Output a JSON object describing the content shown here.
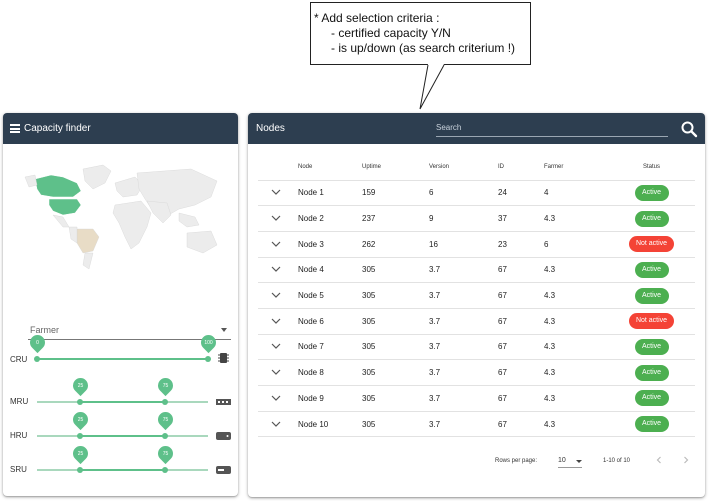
{
  "callout": {
    "line1": "* Add selection criteria :",
    "line2": "- certified capacity Y/N",
    "line3": "- is up/down (as search criterium !)"
  },
  "capacity_finder": {
    "title": "Capacity finder",
    "title_icon": "list-icon",
    "farmer_select": {
      "value": "Farmer"
    },
    "sliders": [
      {
        "label": "CRU",
        "low": 0,
        "high": 100,
        "low_text": "0",
        "high_text": "100",
        "icon": "cpu-icon"
      },
      {
        "label": "MRU",
        "low": 25,
        "high": 75,
        "low_text": "25",
        "high_text": "75",
        "icon": "memory-icon"
      },
      {
        "label": "HRU",
        "low": 25,
        "high": 75,
        "low_text": "25",
        "high_text": "75",
        "icon": "hdd-icon"
      },
      {
        "label": "SRU",
        "low": 25,
        "high": 75,
        "low_text": "25",
        "high_text": "75",
        "icon": "ssd-icon"
      }
    ]
  },
  "nodes_panel": {
    "title": "Nodes",
    "search_placeholder": "Search",
    "columns": [
      "Node",
      "Uptime",
      "Version",
      "ID",
      "Farmer",
      "Status"
    ],
    "rows": [
      {
        "node": "Node 1",
        "uptime": "159",
        "version": "6",
        "id": "24",
        "farmer": "4",
        "status": "Active",
        "active": true
      },
      {
        "node": "Node 2",
        "uptime": "237",
        "version": "9",
        "id": "37",
        "farmer": "4.3",
        "status": "Active",
        "active": true
      },
      {
        "node": "Node 3",
        "uptime": "262",
        "version": "16",
        "id": "23",
        "farmer": "6",
        "status": "Not active",
        "active": false
      },
      {
        "node": "Node 4",
        "uptime": "305",
        "version": "3.7",
        "id": "67",
        "farmer": "4.3",
        "status": "Active",
        "active": true
      },
      {
        "node": "Node 5",
        "uptime": "305",
        "version": "3.7",
        "id": "67",
        "farmer": "4.3",
        "status": "Active",
        "active": true
      },
      {
        "node": "Node 6",
        "uptime": "305",
        "version": "3.7",
        "id": "67",
        "farmer": "4.3",
        "status": "Not active",
        "active": false
      },
      {
        "node": "Node 7",
        "uptime": "305",
        "version": "3.7",
        "id": "67",
        "farmer": "4.3",
        "status": "Active",
        "active": true
      },
      {
        "node": "Node 8",
        "uptime": "305",
        "version": "3.7",
        "id": "67",
        "farmer": "4.3",
        "status": "Active",
        "active": true
      },
      {
        "node": "Node 9",
        "uptime": "305",
        "version": "3.7",
        "id": "67",
        "farmer": "4.3",
        "status": "Active",
        "active": true
      },
      {
        "node": "Node 10",
        "uptime": "305",
        "version": "3.7",
        "id": "67",
        "farmer": "4.3",
        "status": "Active",
        "active": true
      }
    ],
    "pagination": {
      "rows_per_page_label": "Rows per page:",
      "rows_per_page": "10",
      "range": "1-10 of 10"
    }
  },
  "colors": {
    "header": "#2d3e50",
    "active": "#4caf50",
    "inactive": "#f44336",
    "slider": "#5ec08a",
    "map_highlight_green": "#5ec08a",
    "map_highlight_tan": "#e8dcc6",
    "map_land": "#eeeeee"
  }
}
